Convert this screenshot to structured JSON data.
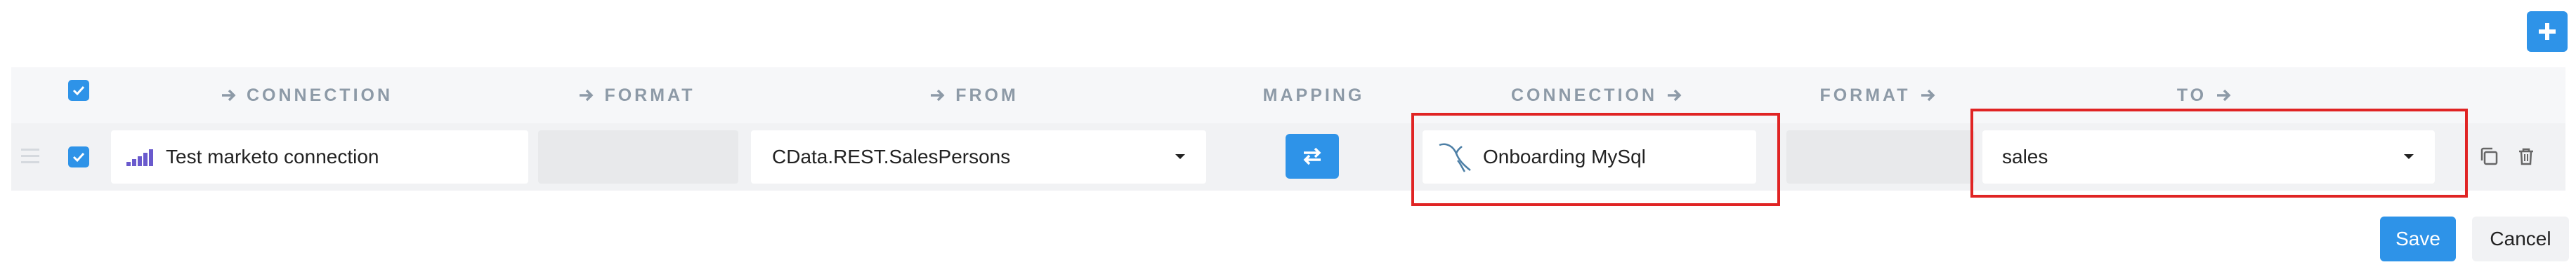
{
  "header": {
    "connection_left": "CONNECTION",
    "format_left": "FORMAT",
    "from": "FROM",
    "mapping": "MAPPING",
    "connection_right": "CONNECTION",
    "format_right": "FORMAT",
    "to": "TO"
  },
  "row": {
    "source_connection": "Test marketo connection",
    "source_format": "",
    "from_value": "CData.REST.SalesPersons",
    "target_connection": "Onboarding MySql",
    "target_format": "",
    "to_value": "sales",
    "selected": true
  },
  "actions": {
    "save": "Save",
    "cancel": "Cancel"
  },
  "colors": {
    "accent": "#2e93e8",
    "highlight": "#e02424",
    "header_text": "#8d9aa7"
  },
  "icons": [
    "plus-icon",
    "check-icon",
    "arrow-right-icon",
    "drag-handle-icon",
    "marketo-icon",
    "dropdown-caret-icon",
    "swap-icon",
    "mysql-icon",
    "copy-icon",
    "trash-icon"
  ]
}
